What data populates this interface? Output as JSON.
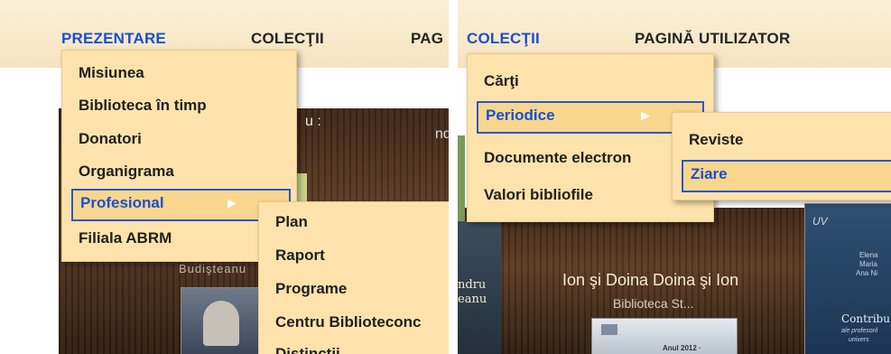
{
  "left": {
    "nav": [
      "PREZENTARE",
      "COLECŢII",
      "PAG"
    ],
    "menu": [
      "Misiunea",
      "Biblioteca în timp",
      "Donatori",
      "Organigrama",
      "Profesional",
      "Filiala ABRM"
    ],
    "submenu": [
      "Plan",
      "Raport",
      "Programe",
      "Centru Biblioteconc",
      "Distinctii"
    ],
    "bg_texts": [
      "u :",
      "ndr",
      "Budişteanu"
    ]
  },
  "right": {
    "nav": [
      "COLECŢII",
      "PAGINĂ UTILIZATOR"
    ],
    "menu": [
      "Cărţi",
      "Periodice",
      "Documente electron",
      "Valori bibliofile"
    ],
    "submenu": [
      "Reviste",
      "Ziare"
    ],
    "captions": {
      "title": "Ion şi Doina Doina şi Ion",
      "subtitle": "Biblioteca St...",
      "side_left_1": "ndru",
      "side_left_2": "eanu",
      "book_right_title": "Contribu",
      "book_right_sub": "ale profesoril",
      "book_right_sub2": "univers",
      "book_mid_year": "Anul 2012 ·",
      "book_right_top_1": "Elena",
      "book_right_top_2": "Maria",
      "book_right_top_3": "Ana Ni"
    }
  },
  "colors": {
    "active": "#1a4fd0",
    "menu_bg": "#fde3ab",
    "selected_border": "#2e56c8"
  }
}
